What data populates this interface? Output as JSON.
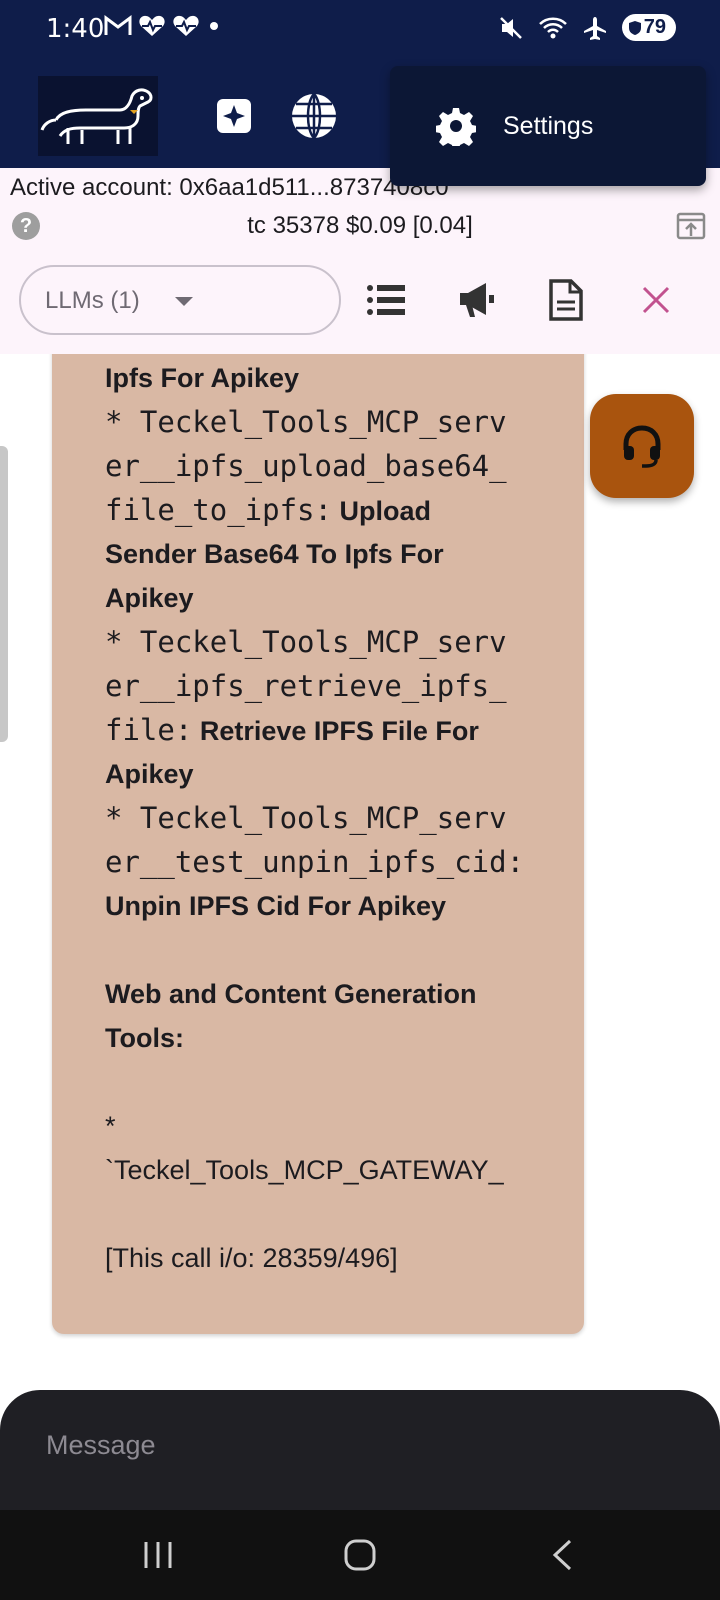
{
  "status_bar": {
    "time": "1:40",
    "battery": "79",
    "left_icons": [
      "gmail-icon",
      "health-icon",
      "health-icon",
      "dot-icon"
    ],
    "right_icons": [
      "mute-icon",
      "wifi-icon",
      "airplane-icon",
      "battery-icon"
    ]
  },
  "toolbar": {
    "icons": [
      "dachshund-logo",
      "sparkle-icon",
      "globe-icon"
    ]
  },
  "settings_menu": {
    "label": "Settings",
    "icon": "gear-icon"
  },
  "account": {
    "active_account": "Active account: 0x6aa1d511...8737408c0",
    "tc_line": "tc 35378 $0.09 [0.04]"
  },
  "llm_select": {
    "label": "LLMs (1)"
  },
  "actions": {
    "icons": [
      "list-icon",
      "megaphone-icon",
      "document-icon",
      "close-icon"
    ],
    "close_color": "#c2528f"
  },
  "message": {
    "lines": [
      {
        "bold": "Ipfs For Apikey"
      },
      {
        "mono": "* Teckel_Tools_MCP_serv"
      },
      {
        "mono": "er__ipfs_upload_base64_"
      },
      {
        "mono": "file_to_ipfs:",
        "bold": " Upload"
      },
      {
        "bold": "Sender Base64 To Ipfs For"
      },
      {
        "bold": "Apikey"
      },
      {
        "mono": "* Teckel_Tools_MCP_serv"
      },
      {
        "mono": "er__ipfs_retrieve_ipfs_"
      },
      {
        "mono": "file:",
        "bold": " Retrieve IPFS File For"
      },
      {
        "bold": "Apikey"
      },
      {
        "mono": "* Teckel_Tools_MCP_serv"
      },
      {
        "mono": "er__test_unpin_ipfs_cid:"
      },
      {
        "bold": "Unpin IPFS Cid For Apikey"
      },
      {
        "bold": "Web and Content Generation"
      },
      {
        "bold": "Tools:"
      },
      {
        "text": "*"
      },
      {
        "text": "`Teckel_Tools_MCP_GATEWAY_"
      },
      {
        "text": "[This call i/o: 28359/496]"
      }
    ]
  },
  "fab": {
    "icon": "headset-icon",
    "color": "#a9540e"
  },
  "input": {
    "placeholder": "Message"
  },
  "colors": {
    "header_bg": "#0f1d4a",
    "bubble_bg": "#d9b8a4",
    "info_bg": "#fdf4fb"
  }
}
